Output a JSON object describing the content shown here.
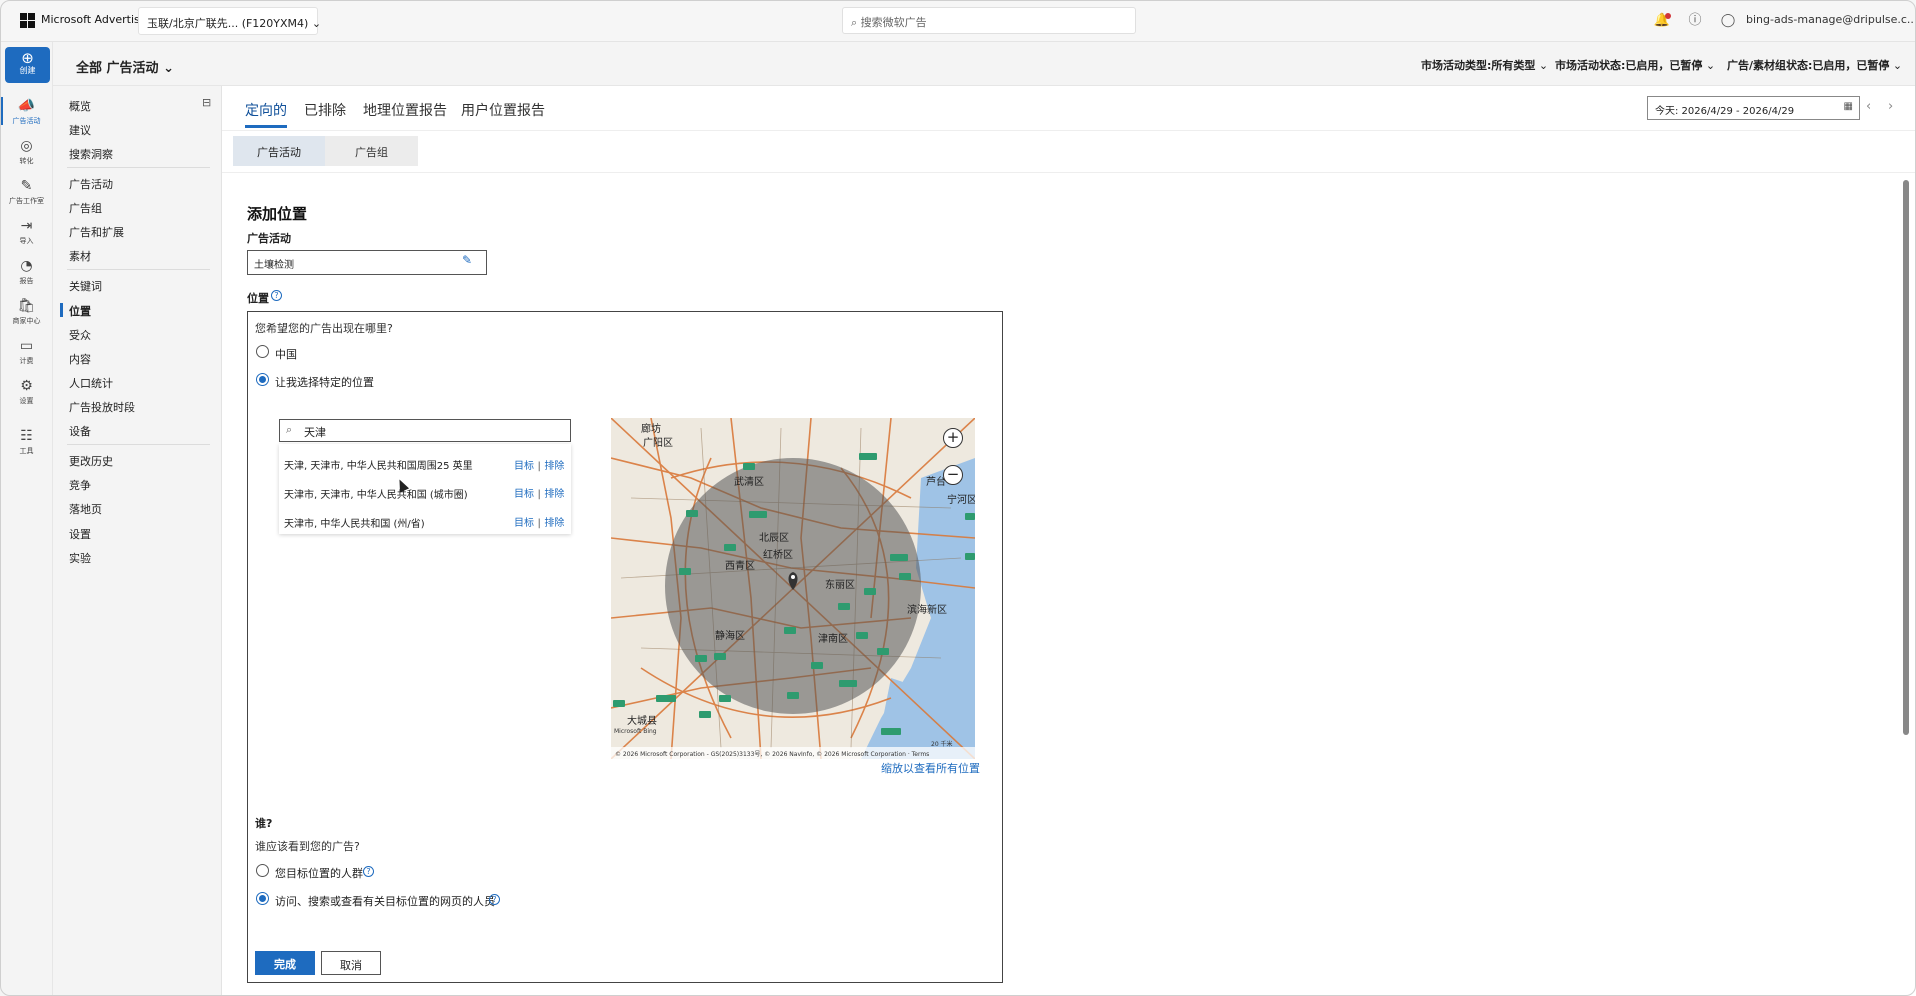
{
  "topbar": {
    "brand": "Microsoft Advertising",
    "account": "玉联/北京广联先...  (F120YXM4)",
    "search_placeholder": "搜索微软广告",
    "user_email": "bing-ads-manage@dripulse.c..."
  },
  "rail": {
    "create": "创建",
    "items": [
      "广告活动",
      "转化",
      "广告工作室",
      "导入",
      "报告",
      "商家中心",
      "计费",
      "设置",
      "工具"
    ]
  },
  "header": {
    "scope": "全部 广告活动",
    "filters": [
      "市场活动类型:所有类型",
      "市场活动状态:已启用，已暂停",
      "广告/素材组状态:已启用，已暂停"
    ]
  },
  "sidenav": {
    "items": [
      "概览",
      "建议",
      "搜索洞察",
      "广告活动",
      "广告组",
      "广告和扩展",
      "素材",
      "关键词",
      "位置",
      "受众",
      "内容",
      "人口统计",
      "广告投放时段",
      "设备",
      "更改历史",
      "竞争",
      "落地页",
      "设置",
      "实验"
    ],
    "active": "位置"
  },
  "tabs": [
    "定向的",
    "已排除",
    "地理位置报告",
    "用户位置报告"
  ],
  "date_range": "今天: 2026/4/29 - 2026/4/29",
  "subtabs": [
    "广告活动",
    "广告组"
  ],
  "form": {
    "title": "添加位置",
    "campaign_label": "广告活动",
    "campaign_value": "土壤检测",
    "location_label": "位置",
    "question": "您希望您的广告出现在哪里?",
    "option_china": "中国",
    "option_specific": "让我选择特定的位置",
    "search_value": "天津",
    "suggestions": [
      {
        "text": "天津, 天津市, 中华人民共和国周围25 英里",
        "target": "目标",
        "exclude": "排除"
      },
      {
        "text": "天津市, 天津市, 中华人民共和国 (城市圈)",
        "target": "目标",
        "exclude": "排除"
      },
      {
        "text": "天津市, 中华人民共和国 (州/省)",
        "target": "目标",
        "exclude": "排除"
      }
    ],
    "zoom_all": "缩放以查看所有位置",
    "who_title": "谁?",
    "who_question": "谁应该看到您的广告?",
    "who_option1": "您目标位置的人群",
    "who_option2": "访问、搜索或查看有关目标位置的网页的人员",
    "done": "完成",
    "cancel": "取消"
  },
  "map": {
    "labels": [
      "廊坊",
      "广阳区",
      "武清区",
      "北辰区",
      "红桥区",
      "西青区",
      "东丽区",
      "静海区",
      "津南区",
      "滨海新区",
      "芦台",
      "宁河区",
      "大城县"
    ],
    "attribution": "© 2026 Microsoft Corporation - GS(2025)3133号, © 2026 NavInfo, © 2026 Microsoft Corporation · Terms",
    "scale": "20 千米",
    "bing": "Microsoft Bing"
  },
  "colors": {
    "accent": "#1e6bbf"
  }
}
